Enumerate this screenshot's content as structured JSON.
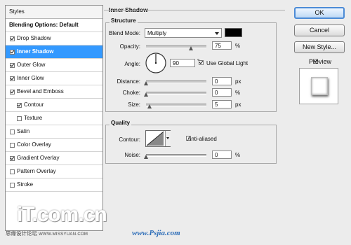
{
  "styles_panel": {
    "header": "Styles",
    "items": [
      {
        "label": "Blending Options: Default",
        "checkbox": false,
        "checked": false,
        "selected": false
      },
      {
        "label": "Drop Shadow",
        "checkbox": true,
        "checked": true,
        "selected": false
      },
      {
        "label": "Inner Shadow",
        "checkbox": true,
        "checked": true,
        "selected": true
      },
      {
        "label": "Outer Glow",
        "checkbox": true,
        "checked": true,
        "selected": false
      },
      {
        "label": "Inner Glow",
        "checkbox": true,
        "checked": true,
        "selected": false
      },
      {
        "label": "Bevel and Emboss",
        "checkbox": true,
        "checked": true,
        "selected": false
      },
      {
        "label": "Contour",
        "checkbox": true,
        "checked": true,
        "selected": false,
        "indent": true
      },
      {
        "label": "Texture",
        "checkbox": true,
        "checked": false,
        "selected": false,
        "indent": true
      },
      {
        "label": "Satin",
        "checkbox": true,
        "checked": false,
        "selected": false
      },
      {
        "label": "Color Overlay",
        "checkbox": true,
        "checked": false,
        "selected": false
      },
      {
        "label": "Gradient Overlay",
        "checkbox": true,
        "checked": true,
        "selected": false
      },
      {
        "label": "Pattern Overlay",
        "checkbox": true,
        "checked": false,
        "selected": false
      },
      {
        "label": "Stroke",
        "checkbox": true,
        "checked": false,
        "selected": false
      }
    ]
  },
  "inner_shadow": {
    "title": "Inner Shadow",
    "structure": {
      "title": "Structure",
      "blend_mode_label": "Blend Mode:",
      "blend_mode_value": "Multiply",
      "shadow_color": "#000000",
      "opacity_label": "Opacity:",
      "opacity_value": "75",
      "opacity_unit": "%",
      "opacity_fraction": 0.75,
      "angle_label": "Angle:",
      "angle_value": "90",
      "angle_unit": "°",
      "use_global_light_label": "Use Global Light",
      "use_global_light": true,
      "distance_label": "Distance:",
      "distance_value": "0",
      "distance_unit": "px",
      "choke_label": "Choke:",
      "choke_value": "0",
      "choke_unit": "%",
      "size_label": "Size:",
      "size_value": "5",
      "size_unit": "px"
    },
    "quality": {
      "title": "Quality",
      "contour_label": "Contour:",
      "anti_aliased_label": "Anti-aliased",
      "anti_aliased": false,
      "noise_label": "Noise:",
      "noise_value": "0",
      "noise_unit": "%"
    }
  },
  "buttons": {
    "ok": "OK",
    "cancel": "Cancel",
    "new_style": "New Style...",
    "preview_label": "Preview",
    "preview_checked": true
  },
  "watermark": {
    "left_line": "思缘设计论坛",
    "left_url": "WWW.MISSYUAN.COM",
    "right_url": "www.Psjia.com"
  },
  "colors": {
    "selection": "#3399ff",
    "shadow_swatch": "#000000"
  }
}
